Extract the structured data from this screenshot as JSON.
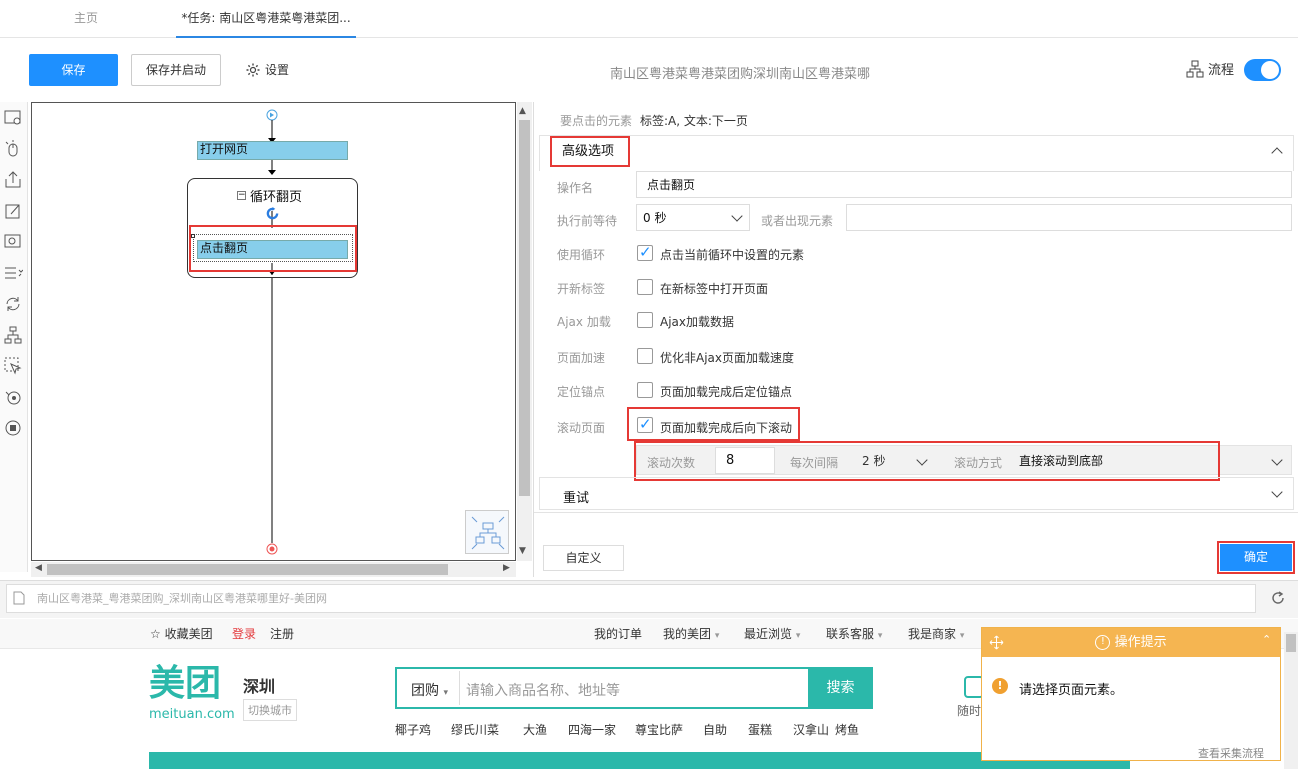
{
  "tabs": {
    "home": "主页",
    "task": "*任务: 南山区粤港菜粤港菜团..."
  },
  "toolbar": {
    "save": "保存",
    "save_start": "保存并启动",
    "settings": "设置",
    "page_title": "南山区粤港菜粤港菜团购深圳南山区粤港菜哪",
    "flow_label": "流程",
    "flow_toggle": "on"
  },
  "flow": {
    "open_page": "打开网页",
    "loop": "循环翻页",
    "click_page": "点击翻页"
  },
  "panel": {
    "element_label": "要点击的元素",
    "element_value": "标签:A, 文本:下一页",
    "advanced": "高级选项",
    "op_name_label": "操作名",
    "op_name_value": "点击翻页",
    "wait_label": "执行前等待",
    "wait_value": "0 秒",
    "or_appear_label": "或者出现元素",
    "or_appear_value": "",
    "loop_label": "使用循环",
    "loop_text": "点击当前循环中设置的元素",
    "loop_checked": true,
    "newtab_label": "开新标签",
    "newtab_text": "在新标签中打开页面",
    "newtab_checked": false,
    "ajax_label": "Ajax 加载",
    "ajax_text": "Ajax加载数据",
    "ajax_checked": false,
    "speed_label": "页面加速",
    "speed_text": "优化非Ajax页面加载速度",
    "speed_checked": false,
    "anchor_label": "定位锚点",
    "anchor_text": "页面加载完成后定位锚点",
    "anchor_checked": false,
    "scroll_label": "滚动页面",
    "scroll_text": "页面加载完成后向下滚动",
    "scroll_checked": true,
    "scroll_count_label": "滚动次数",
    "scroll_count_value": "8",
    "interval_label": "每次间隔",
    "interval_value": "2 秒",
    "scroll_mode_label": "滚动方式",
    "scroll_mode_value": "直接滚动到底部",
    "retry": "重试",
    "custom": "自定义",
    "confirm": "确定"
  },
  "browser": {
    "url": "南山区粤港菜_粤港菜团购_深圳南山区粤港菜哪里好-美团网"
  },
  "site": {
    "fav": "收藏美团",
    "login": "登录",
    "register": "注册",
    "nav": [
      "我的订单",
      "我的美团",
      "最近浏览",
      "联系客服",
      "我是商家"
    ],
    "logo": "美团",
    "logo_domain": "meituan.com",
    "city": "深圳",
    "switch_city": "切换城市",
    "search_cat": "团购",
    "search_placeholder": "请输入商品名称、地址等",
    "search_btn": "搜索",
    "hot": [
      "椰子鸡",
      "缪氏川菜",
      "大渔",
      "四海一家",
      "尊宝比萨",
      "自助",
      "蛋糕",
      "汉拿山",
      "烤鱼"
    ],
    "side_text": "随时"
  },
  "tip": {
    "title": "操作提示",
    "message": "请选择页面元素。",
    "link": "查看采集流程"
  },
  "colors": {
    "accent": "#1e90ff",
    "highlight": "#e53935",
    "brand": "#2bb8aa",
    "tip": "#f5b551"
  }
}
